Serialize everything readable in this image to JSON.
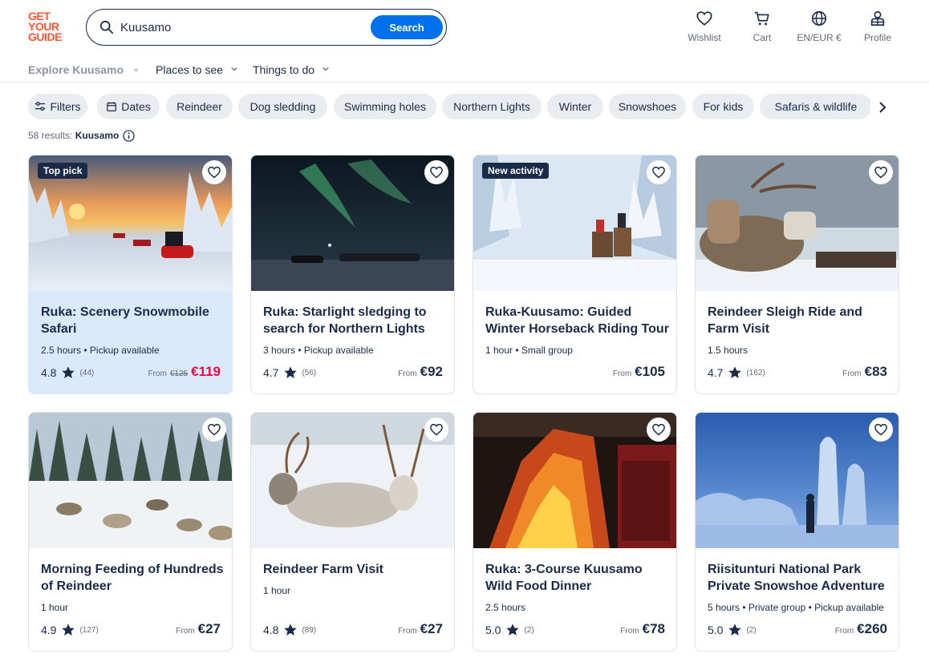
{
  "logo": [
    "GET",
    "YOUR",
    "GUIDE"
  ],
  "search": {
    "value": "Kuusamo",
    "button": "Search"
  },
  "header": {
    "wishlist": "Wishlist",
    "cart": "Cart",
    "lang": "EN/EUR €",
    "profile": "Profile"
  },
  "subnav": {
    "explore": "Explore Kuusamo",
    "places": "Places to see",
    "things": "Things to do"
  },
  "chips": [
    "Filters",
    "Dates",
    "Reindeer",
    "Dog sledding",
    "Swimming holes",
    "Northern Lights",
    "Winter",
    "Snowshoes",
    "For kids",
    "Safaris & wildlife"
  ],
  "results": {
    "count": "58 results:",
    "place": "Kuusamo"
  },
  "cards": [
    {
      "badge": "Top pick",
      "title": "Ruka: Scenery Snowmobile Safari",
      "meta": "2.5 hours • Pickup available",
      "rating": "4.8",
      "count": "(44)",
      "from": "From",
      "old": "€125",
      "price": "€119"
    },
    {
      "title": "Ruka: Starlight sledging to search for Northern Lights",
      "meta": "3 hours • Pickup available",
      "rating": "4.7",
      "count": "(56)",
      "from": "From",
      "price": "€92"
    },
    {
      "badge": "New activity",
      "title": "Ruka-Kuusamo: Guided Winter Horseback Riding Tour",
      "meta": "1 hour • Small group",
      "from": "From",
      "price": "€105"
    },
    {
      "title": "Reindeer Sleigh Ride and Farm Visit",
      "meta": "1.5 hours",
      "rating": "4.7",
      "count": "(162)",
      "from": "From",
      "price": "€83"
    },
    {
      "title": "Morning Feeding of Hundreds of Reindeer",
      "meta": "1 hour",
      "rating": "4.9",
      "count": "(127)",
      "from": "From",
      "price": "€27"
    },
    {
      "title": "Reindeer Farm Visit",
      "meta": "1 hour",
      "rating": "4.8",
      "count": "(89)",
      "from": "From",
      "price": "€27"
    },
    {
      "title": "Ruka: 3-Course Kuusamo Wild Food Dinner",
      "meta": "2.5 hours",
      "rating": "5.0",
      "count": "(2)",
      "from": "From",
      "price": "€78"
    },
    {
      "title": "Riisitunturi National Park Private Snowshoe Adventure",
      "meta": "5 hours • Private group • Pickup available",
      "rating": "5.0",
      "count": "(2)",
      "from": "From",
      "price": "€260"
    }
  ]
}
